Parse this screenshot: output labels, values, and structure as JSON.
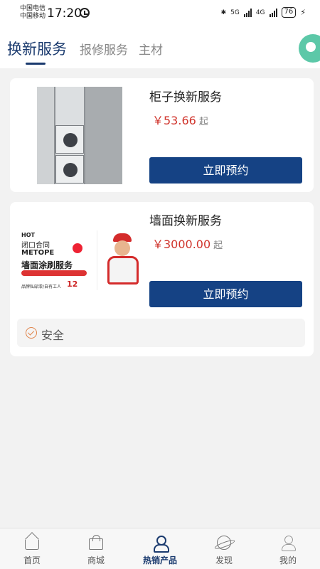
{
  "status_bar": {
    "carrier1": "中国电信",
    "carrier2": "中国移动",
    "time": "17:20",
    "net1": "5G",
    "net2": "4G",
    "battery": "76"
  },
  "top_tabs": [
    {
      "label": "换新服务",
      "active": true
    },
    {
      "label": "报修服务",
      "active": false
    },
    {
      "label": "主材",
      "active": false
    }
  ],
  "cards": [
    {
      "title": "柜子换新服务",
      "price": "￥53.66",
      "price_suffix": "起",
      "button": "立即预约"
    },
    {
      "title": "墙面换新服务",
      "price": "￥3000.00",
      "price_suffix": "起",
      "button": "立即预约",
      "poster": {
        "hot": "HOT",
        "line1": "闭口合同",
        "line2": "METOPE",
        "line3": "墙面涂刷服务",
        "foot": "品牌私邸漆/自有工人",
        "number": "12"
      },
      "tag": "安全"
    }
  ],
  "bottom_nav": [
    {
      "label": "首页",
      "icon": "home-icon",
      "active": false
    },
    {
      "label": "商城",
      "icon": "shopping-bag-icon",
      "active": false
    },
    {
      "label": "热销产品",
      "icon": "hot-products-icon",
      "active": true
    },
    {
      "label": "发现",
      "icon": "planet-icon",
      "active": false
    },
    {
      "label": "我的",
      "icon": "profile-icon",
      "active": false
    }
  ],
  "colors": {
    "accent": "#1a3a6e",
    "button": "#154284",
    "price": "#d0342c",
    "safe_icon": "#e0844a"
  }
}
